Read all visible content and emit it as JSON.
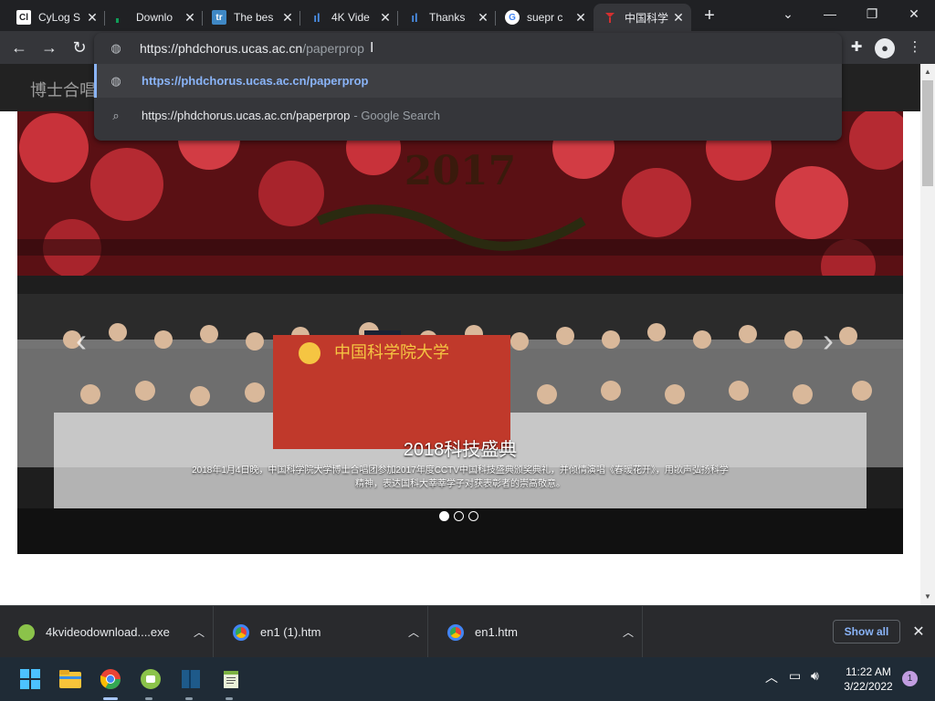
{
  "browser": {
    "tabs": [
      {
        "title": "CyLog S",
        "favicon_text": "Cl"
      },
      {
        "title": "Downlo",
        "favicon_text": ""
      },
      {
        "title": "The bes",
        "favicon_text": "tr"
      },
      {
        "title": "4K Vide",
        "favicon_text": "ıl"
      },
      {
        "title": "Thanks",
        "favicon_text": "ıl"
      },
      {
        "title": "suepr c",
        "favicon_text": "G"
      },
      {
        "title": "中国科学",
        "favicon_text": ""
      }
    ],
    "active_tab_index": 6,
    "new_tab_label": "+",
    "window_controls": {
      "dropdown": "⌄",
      "minimize": "—",
      "restore": "❐",
      "close": "✕"
    },
    "nav": {
      "back": "←",
      "forward": "→",
      "reload": "↻"
    },
    "omnibox": {
      "url_host": "https://phdchorus.ucas.ac.cn",
      "url_path": "/paperprop",
      "suggestions": [
        {
          "text": "https://phdchorus.ucas.ac.cn/paperprop",
          "suffix": ""
        },
        {
          "text": "https://phdchorus.ucas.ac.cn/paperprop",
          "suffix": "- Google Search"
        }
      ]
    }
  },
  "page": {
    "brand": "博士合唱",
    "carousel": {
      "caption_title": "2018科技盛典",
      "caption_text": "2018年1月4日晚，中国科学院大学博士合唱团参加2017年度CCTV中国科技盛典颁奖典礼，并倾情演唱《春暖花开》，用歌声弘扬科学精神，表达国科大莘莘学子对获表彰者的崇高敬意。",
      "backdrop_year": "2017",
      "banner_text": "中国科学院大学",
      "slide_count": 3,
      "active_slide": 0,
      "prev_label": "‹",
      "next_label": "›"
    }
  },
  "downloads": {
    "items": [
      {
        "name": "4kvideodownload....exe",
        "icon_color": "#8bc34a"
      },
      {
        "name": "en1 (1).htm",
        "icon_color": "#4285f4"
      },
      {
        "name": "en1.htm",
        "icon_color": "#4285f4"
      }
    ],
    "show_all_label": "Show all",
    "close_label": "✕"
  },
  "taskbar": {
    "time": "11:22 AM",
    "date": "3/22/2022",
    "notification_count": "1"
  },
  "colors": {
    "accent": "#8ab4f8",
    "taskbar_bg": "#1f2b36",
    "chrome_dark": "#202124"
  }
}
